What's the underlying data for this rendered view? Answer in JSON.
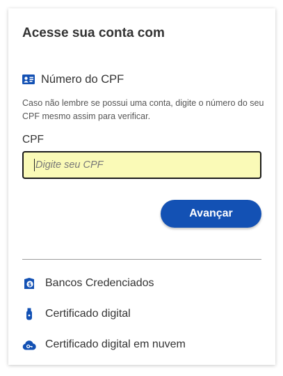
{
  "login": {
    "title": "Acesse sua conta com",
    "cpf_option": {
      "label": "Número do CPF",
      "icon": "id-card-icon"
    },
    "hint": "Caso não lembre se possui uma conta, digite o número do seu CPF mesmo assim para verificar.",
    "field_label": "CPF",
    "input_value": "",
    "input_placeholder": "Digite seu CPF",
    "submit_label": "Avançar"
  },
  "alternatives": [
    {
      "label": "Bancos Credenciados",
      "icon": "bank-coin-icon"
    },
    {
      "label": "Certificado digital",
      "icon": "usb-token-icon"
    },
    {
      "label": "Certificado digital em nuvem",
      "icon": "cloud-key-icon"
    }
  ],
  "colors": {
    "accent": "#1351b4",
    "input_background": "#fafab7",
    "text": "#333333"
  }
}
